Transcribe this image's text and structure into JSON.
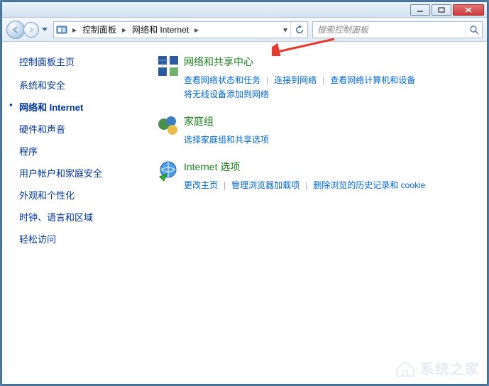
{
  "titlebar": {
    "min": "–",
    "max": "□",
    "close": "×"
  },
  "address": {
    "seg1": "控制面板",
    "seg2": "网络和 Internet"
  },
  "search": {
    "placeholder": "搜索控制面板"
  },
  "sidebar": {
    "title": "控制面板主页",
    "items": [
      "系统和安全",
      "网络和 Internet",
      "硬件和声音",
      "程序",
      "用户帐户和家庭安全",
      "外观和个性化",
      "时钟、语言和区域",
      "轻松访问"
    ],
    "active_index": 1
  },
  "sections": [
    {
      "title": "网络和共享中心",
      "links": [
        [
          "查看网络状态和任务",
          "连接到网络",
          "查看网络计算机和设备"
        ],
        [
          "将无线设备添加到网络"
        ]
      ]
    },
    {
      "title": "家庭组",
      "links": [
        [
          "选择家庭组和共享选项"
        ]
      ]
    },
    {
      "title": "Internet 选项",
      "links": [
        [
          "更改主页",
          "管理浏览器加载项",
          "删除浏览的历史记录和 cookie"
        ]
      ]
    }
  ],
  "watermark": "系统之家"
}
